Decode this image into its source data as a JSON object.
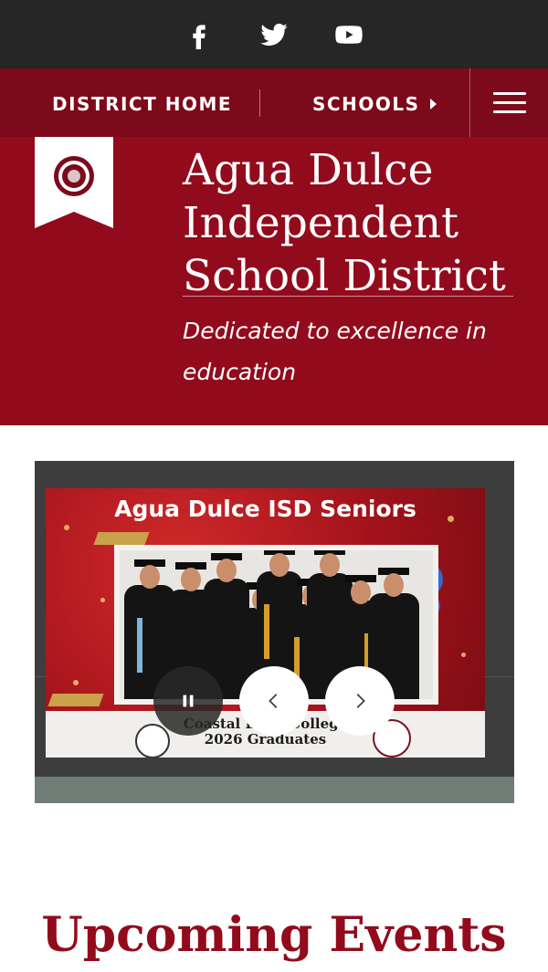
{
  "social": {
    "icons": [
      "facebook-icon",
      "twitter-icon",
      "youtube-icon"
    ]
  },
  "nav": {
    "home_label": "DISTRICT HOME",
    "schools_label": "SCHOOLS",
    "menu_icon": "hamburger-menu-icon"
  },
  "header": {
    "title": "Agua Dulce Independent School District",
    "tagline": "Dedicated to excellence in education"
  },
  "slideshow": {
    "slide_heading": "Agua Dulce ISD Seniors",
    "caption_line1": "Coastal Bend College",
    "caption_line2": "2026 Graduates",
    "controls": [
      "pause-icon",
      "chevron-left-icon",
      "chevron-right-icon"
    ]
  },
  "events": {
    "heading": "Upcoming Events"
  },
  "colors": {
    "brand_dark": "#7c0a1b",
    "brand": "#920b1c",
    "social_bar": "#262626"
  }
}
